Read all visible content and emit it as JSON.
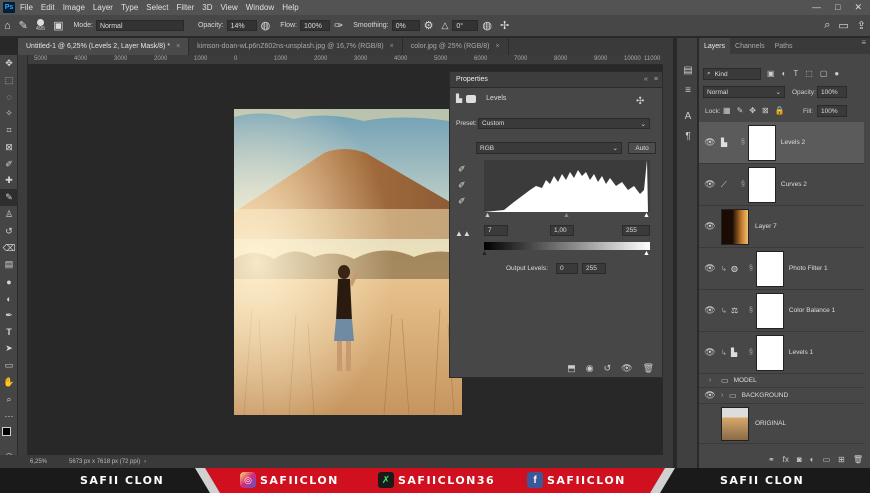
{
  "menubar": {
    "items": [
      "File",
      "Edit",
      "Image",
      "Layer",
      "Type",
      "Select",
      "Filter",
      "3D",
      "View",
      "Window",
      "Help"
    ],
    "logo": "Ps"
  },
  "options": {
    "brush_size": "495",
    "mode_label": "Mode:",
    "mode_value": "Normal",
    "opacity_label": "Opacity:",
    "opacity_value": "14%",
    "flow_label": "Flow:",
    "flow_value": "100%",
    "smoothing_label": "Smoothing:",
    "smoothing_value": "0%",
    "angle_value": "0°"
  },
  "tabs": [
    {
      "label": "Untitled-1 @ 6,25% (Levels 2, Layer Mask/8) *",
      "active": true
    },
    {
      "label": "kimson-doan-wLp6nZ602ns-unsplash.jpg @ 16,7% (RGB/8)",
      "active": false
    },
    {
      "label": "color.jpg @ 25% (RGB/8)",
      "active": false
    }
  ],
  "ruler": [
    "5000",
    "4000",
    "3000",
    "2000",
    "1000",
    "0",
    "1000",
    "2000",
    "3000",
    "4000",
    "5000",
    "6000",
    "7000",
    "8000",
    "9000",
    "10000",
    "11000"
  ],
  "status": {
    "zoom": "6,25%",
    "doc_info": "5673 px x 7618 px (72 ppi)"
  },
  "properties": {
    "title": "Properties",
    "adjustment_label": "Levels",
    "preset_label": "Preset:",
    "preset_value": "Custom",
    "channel_value": "RGB",
    "auto_label": "Auto",
    "input_black": "7",
    "input_mid": "1,00",
    "input_white": "255",
    "output_label": "Output Levels:",
    "output_black": "0",
    "output_white": "255"
  },
  "layers_panel": {
    "tabs": [
      "Layers",
      "Channels",
      "Paths"
    ],
    "kind_label": "Kind",
    "blend_mode": "Normal",
    "opacity_label": "Opacity:",
    "opacity_value": "100%",
    "lock_label": "Lock:",
    "fill_label": "Fill:",
    "fill_value": "100%",
    "layers": [
      {
        "name": "Levels 2",
        "kind": "levels",
        "selected": true
      },
      {
        "name": "Curves 2",
        "kind": "curves",
        "selected": false
      },
      {
        "name": "Layer 7",
        "kind": "pixel",
        "selected": false
      },
      {
        "name": "Photo Filter 1",
        "kind": "photofilter",
        "selected": false
      },
      {
        "name": "Color Balance 1",
        "kind": "colorbalance",
        "selected": false
      },
      {
        "name": "Levels 1",
        "kind": "levels",
        "selected": false
      },
      {
        "name": "MODEL",
        "kind": "group",
        "selected": false
      },
      {
        "name": "BACKGROUND",
        "kind": "group",
        "selected": false
      },
      {
        "name": "ORIGINAL",
        "kind": "image",
        "selected": false
      }
    ]
  },
  "banner": {
    "left_name": "SAFII CLON",
    "instagram": "SAFIICLON",
    "other": "SAFIICLON36",
    "facebook": "SAFIICLON",
    "right_name": "SAFII CLON",
    "accent": "#d0101e"
  }
}
